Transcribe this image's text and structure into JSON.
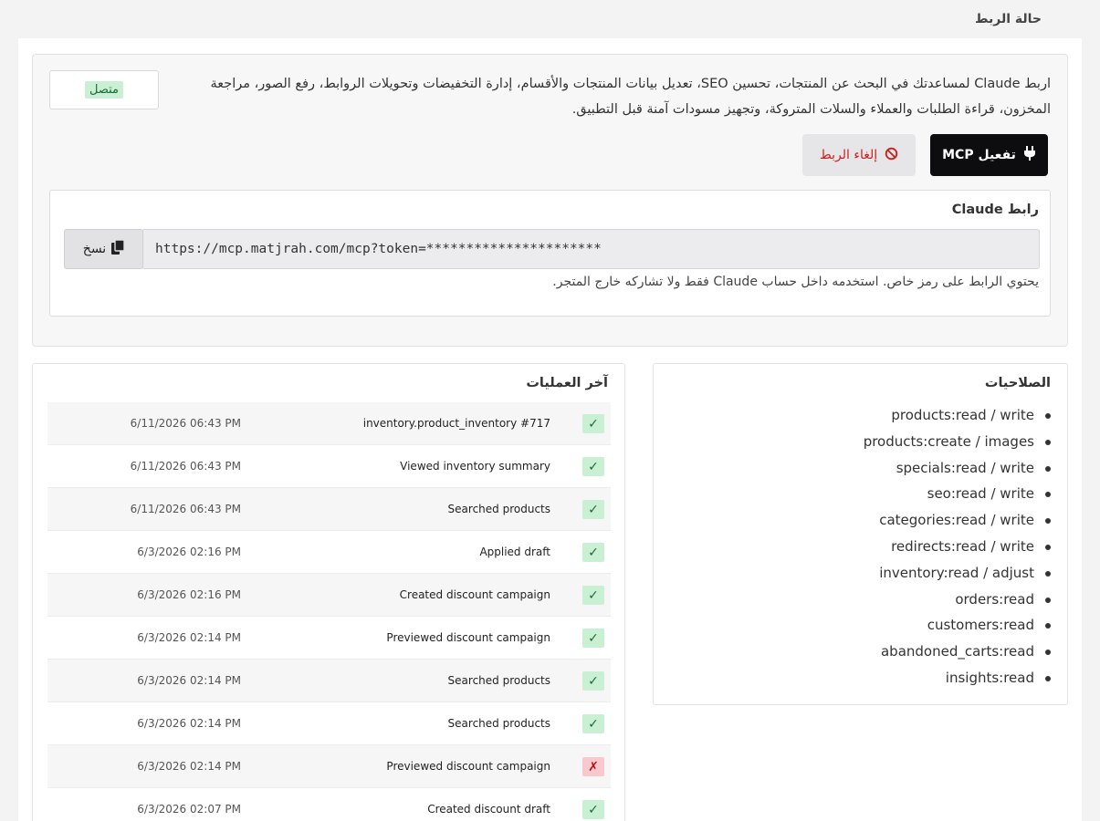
{
  "header": {
    "title": "حالة الربط"
  },
  "connection": {
    "description": "اربط Claude لمساعدتك في البحث عن المنتجات، تحسين SEO، تعديل بيانات المنتجات والأقسام، إدارة التخفيضات وتحويلات الروابط، رفع الصور، مراجعة المخزون، قراءة الطلبات والعملاء والسلات المتروكة، وتجهيز مسودات آمنة قبل التطبيق.",
    "status": "متصل",
    "status_color": "#c9f0d3",
    "activate_label": "تفعيل MCP",
    "activate_icon": "plug-icon",
    "revoke_label": "إلغاء الربط",
    "revoke_icon": "ban-icon"
  },
  "link": {
    "label": "رابط Claude",
    "url": "https://mcp.matjrah.com/mcp?token=**********************",
    "copy_label": "نسخ",
    "copy_icon": "copy-icon",
    "note": "يحتوي الرابط على رمز خاص. استخدمه داخل حساب Claude فقط ولا تشاركه خارج المتجر."
  },
  "permissions": {
    "title": "الصلاحيات",
    "items": [
      "products:read / write",
      "products:create / images",
      "specials:read / write",
      "seo:read / write",
      "categories:read / write",
      "redirects:read / write",
      "inventory:read / adjust",
      "orders:read",
      "customers:read",
      "abandoned_carts:read",
      "insights:read"
    ]
  },
  "operations": {
    "title": "آخر العمليات",
    "rows": [
      {
        "status": "ok",
        "icon": "✓",
        "action": "inventory.product_inventory #717",
        "time": "6/11/2026 06:43 PM"
      },
      {
        "status": "ok",
        "icon": "✓",
        "action": "Viewed inventory summary",
        "time": "6/11/2026 06:43 PM"
      },
      {
        "status": "ok",
        "icon": "✓",
        "action": "Searched products",
        "time": "6/11/2026 06:43 PM"
      },
      {
        "status": "ok",
        "icon": "✓",
        "action": "Applied draft",
        "time": "6/3/2026 02:16 PM"
      },
      {
        "status": "ok",
        "icon": "✓",
        "action": "Created discount campaign",
        "time": "6/3/2026 02:16 PM"
      },
      {
        "status": "ok",
        "icon": "✓",
        "action": "Previewed discount campaign",
        "time": "6/3/2026 02:14 PM"
      },
      {
        "status": "ok",
        "icon": "✓",
        "action": "Searched products",
        "time": "6/3/2026 02:14 PM"
      },
      {
        "status": "ok",
        "icon": "✓",
        "action": "Searched products",
        "time": "6/3/2026 02:14 PM"
      },
      {
        "status": "fail",
        "icon": "✗",
        "action": "Previewed discount campaign",
        "time": "6/3/2026 02:14 PM"
      },
      {
        "status": "ok",
        "icon": "✓",
        "action": "Created discount draft",
        "time": "6/3/2026 02:07 PM"
      }
    ]
  }
}
